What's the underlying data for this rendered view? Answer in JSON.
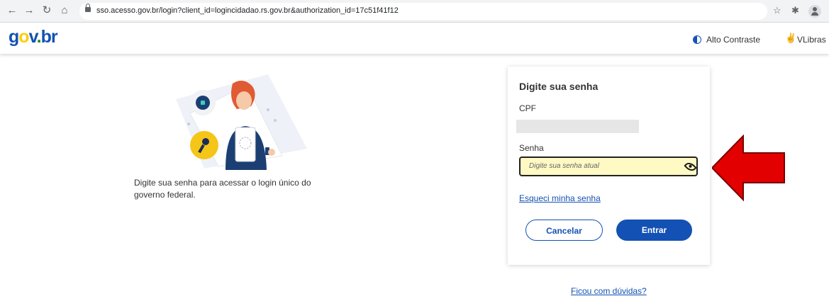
{
  "browser": {
    "url": "sso.acesso.gov.br/login?client_id=logincidadao.rs.gov.br&authorization_id=17c51f41f12"
  },
  "header": {
    "logo": {
      "g": "g",
      "o": "o",
      "v": "v",
      "dot": ".",
      "br": "br"
    },
    "contrast_label": "Alto Contraste",
    "vlibras_label": "VLibras"
  },
  "left": {
    "description": "Digite sua senha para acessar o login único do governo federal."
  },
  "card": {
    "title": "Digite sua senha",
    "cpf_label": "CPF",
    "password_label": "Senha",
    "password_placeholder": "Digite sua senha atual",
    "password_value": "",
    "forgot_link": "Esqueci minha senha",
    "cancel_button": "Cancelar",
    "submit_button": "Entrar"
  },
  "help_link": "Ficou com dúvidas?",
  "colors": {
    "primary": "#1351b4",
    "highlight_field": "#fff9c4",
    "arrow": "#e30000"
  }
}
